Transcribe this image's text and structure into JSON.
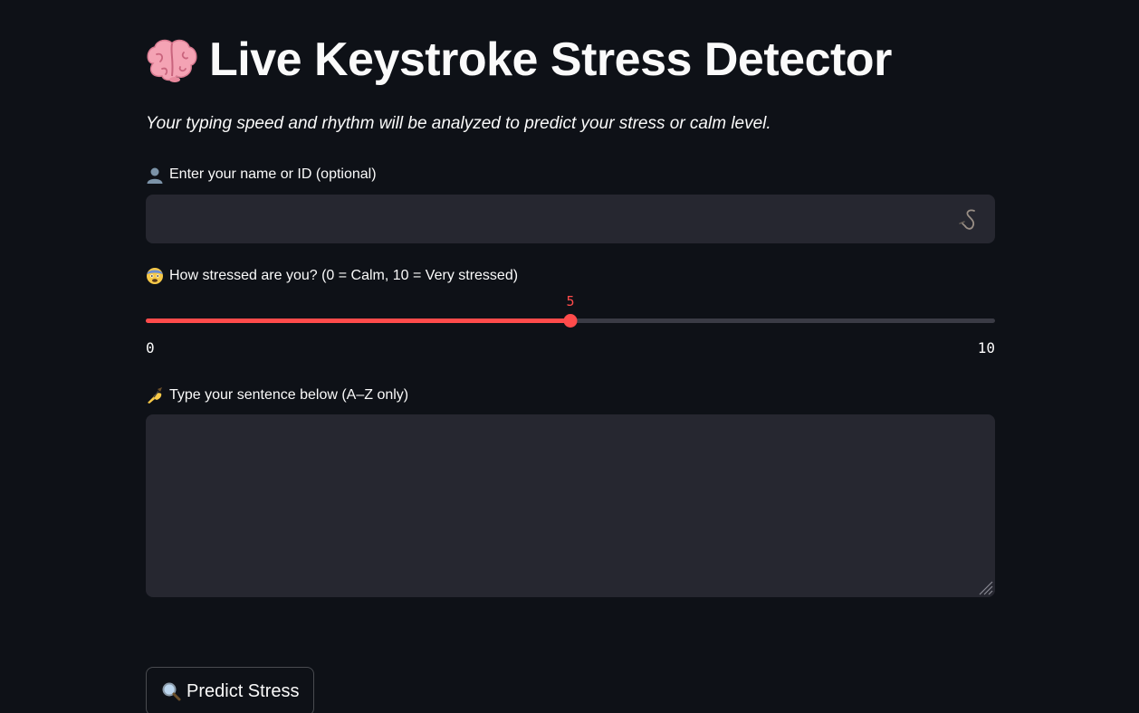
{
  "header": {
    "title": "Live Keystroke Stress Detector",
    "title_icon": "brain-icon"
  },
  "subtitle": "Your typing speed and rhythm will be analyzed to predict your stress or calm level.",
  "name_field": {
    "icon": "user-silhouette-icon",
    "label": "Enter your name or ID (optional)",
    "value": "",
    "placeholder": "",
    "extension_icon": "hook-icon"
  },
  "stress_slider": {
    "icon": "anxious-face-icon",
    "label": "How stressed are you? (0 = Calm, 10 = Very stressed)",
    "value": 5,
    "value_label": "5",
    "min": 0,
    "max": 10,
    "min_label": "0",
    "max_label": "10",
    "accent_color": "#ff4b4b",
    "track_color": "#3a3b45"
  },
  "sentence_field": {
    "icon": "writing-hand-icon",
    "label": "Type your sentence below (A–Z only)",
    "value": "",
    "placeholder": ""
  },
  "predict_button": {
    "icon": "magnifying-glass-icon",
    "label": "Predict Stress"
  },
  "theme": {
    "background": "#0e1117",
    "input_background": "#262730",
    "text": "#fafafa"
  }
}
